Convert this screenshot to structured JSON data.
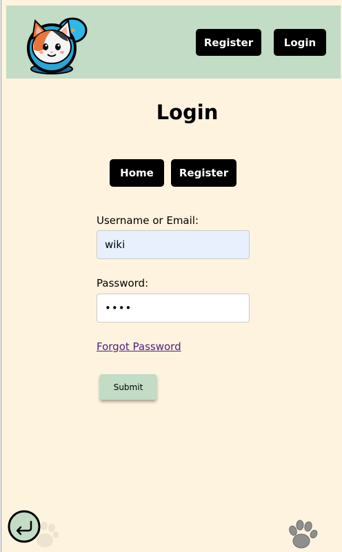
{
  "header": {
    "logo_icon": "cat-chat-logo-icon",
    "register_label": "Register",
    "login_label": "Login"
  },
  "main": {
    "title": "Login",
    "nav": {
      "home_label": "Home",
      "register_label": "Register"
    },
    "form": {
      "username_label": "Username or Email:",
      "username_value": "wiki",
      "password_label": "Password:",
      "password_value": "wiki",
      "forgot_label": "Forgot Password",
      "submit_label": "Submit"
    }
  },
  "footer": {
    "back_icon": "return-arrow-icon",
    "paw_icon": "paw-print-icon"
  },
  "colors": {
    "header_bg": "#c2dcc6",
    "page_bg": "#fdf3df",
    "button_bg": "#000000",
    "submit_bg": "#c2dcc6",
    "autofill_bg": "#e8f0fe",
    "link": "#4b1c80"
  }
}
